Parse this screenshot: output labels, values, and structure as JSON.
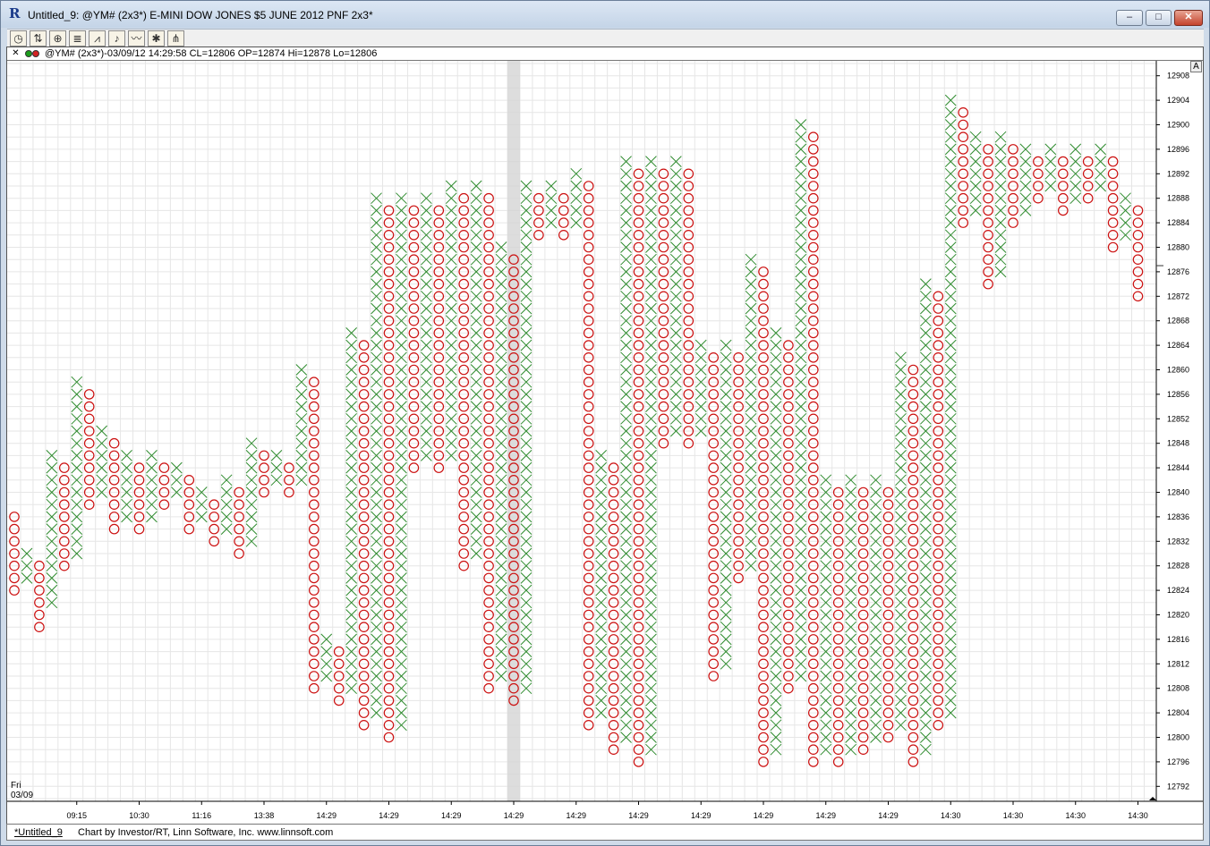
{
  "window": {
    "app_icon": "R",
    "title": "Untitled_9: @YM# (2x3*) E-MINI DOW JONES $5 JUNE 2012 PNF 2x3*",
    "min_symbol": "–",
    "max_symbol": "□",
    "close_symbol": "✕"
  },
  "toolbar": {
    "tools": [
      {
        "icon": "clock-icon",
        "glyph": "◷"
      },
      {
        "icon": "bar-chart-icon",
        "glyph": "⇅"
      },
      {
        "icon": "zoom-icon",
        "glyph": "⊕"
      },
      {
        "icon": "list-icon",
        "glyph": "≣"
      },
      {
        "icon": "line-chart-icon",
        "glyph": "⩘"
      },
      {
        "icon": "alert-bell-icon",
        "glyph": "♪"
      },
      {
        "icon": "indicator-icon",
        "glyph": "〰"
      },
      {
        "icon": "draw-icon",
        "glyph": "✱"
      },
      {
        "icon": "fib-icon",
        "glyph": "⋔"
      }
    ]
  },
  "info": {
    "close_symbol": "✕",
    "text": "@YM# (2x3*)-03/09/12 14:29:58 CL=12806 OP=12874 Hi=12878 Lo=12806"
  },
  "corner_button": "A",
  "day_label": {
    "day": "Fri",
    "date": "03/09"
  },
  "status": {
    "tab": "*Untitled_9",
    "credit": "Chart by Investor/RT, Linn Software, Inc. www.linnsoft.com"
  },
  "colors": {
    "x_mark": "#2e8b2e",
    "o_mark": "#cc1111",
    "grid": "#e6e6e6",
    "highlight": "#d4d4d4"
  },
  "chart_data": {
    "type": "point-and-figure",
    "box_size": 2,
    "reversal": 3,
    "ylim": [
      12790,
      12910
    ],
    "y_ticks": [
      12792,
      12796,
      12800,
      12804,
      12808,
      12812,
      12816,
      12820,
      12824,
      12828,
      12832,
      12836,
      12840,
      12844,
      12848,
      12852,
      12856,
      12860,
      12864,
      12868,
      12872,
      12876,
      12880,
      12884,
      12888,
      12892,
      12896,
      12900,
      12904,
      12908
    ],
    "last_price_marker": 12877,
    "highlight_column": 40,
    "time_labels": [
      {
        "col": 5,
        "label": "09:15"
      },
      {
        "col": 10,
        "label": "10:30"
      },
      {
        "col": 15,
        "label": "11:16"
      },
      {
        "col": 20,
        "label": "13:38"
      },
      {
        "col": 25,
        "label": "14:29"
      },
      {
        "col": 30,
        "label": "14:29"
      },
      {
        "col": 35,
        "label": "14:29"
      },
      {
        "col": 40,
        "label": "14:29"
      },
      {
        "col": 45,
        "label": "14:29"
      },
      {
        "col": 50,
        "label": "14:29"
      },
      {
        "col": 55,
        "label": "14:29"
      },
      {
        "col": 60,
        "label": "14:29"
      },
      {
        "col": 65,
        "label": "14:29"
      },
      {
        "col": 70,
        "label": "14:29"
      },
      {
        "col": 75,
        "label": "14:30"
      },
      {
        "col": 80,
        "label": "14:30"
      },
      {
        "col": 85,
        "label": "14:30"
      },
      {
        "col": 90,
        "label": "14:30"
      }
    ],
    "columns": [
      [
        "O",
        12836,
        12824
      ],
      [
        "X",
        12830,
        12826
      ],
      [
        "O",
        12828,
        12818
      ],
      [
        "X",
        12822,
        12846
      ],
      [
        "O",
        12844,
        12828
      ],
      [
        "X",
        12830,
        12858
      ],
      [
        "O",
        12856,
        12838
      ],
      [
        "X",
        12840,
        12850
      ],
      [
        "O",
        12848,
        12834
      ],
      [
        "X",
        12836,
        12846
      ],
      [
        "O",
        12844,
        12834
      ],
      [
        "X",
        12836,
        12846
      ],
      [
        "O",
        12844,
        12838
      ],
      [
        "X",
        12840,
        12844
      ],
      [
        "O",
        12842,
        12834
      ],
      [
        "X",
        12836,
        12840
      ],
      [
        "O",
        12838,
        12832
      ],
      [
        "X",
        12834,
        12842
      ],
      [
        "O",
        12840,
        12830
      ],
      [
        "X",
        12832,
        12848
      ],
      [
        "O",
        12846,
        12840
      ],
      [
        "X",
        12842,
        12846
      ],
      [
        "O",
        12844,
        12840
      ],
      [
        "X",
        12842,
        12860
      ],
      [
        "O",
        12858,
        12808
      ],
      [
        "X",
        12810,
        12816
      ],
      [
        "O",
        12814,
        12806
      ],
      [
        "X",
        12808,
        12866
      ],
      [
        "O",
        12864,
        12802
      ],
      [
        "X",
        12804,
        12888
      ],
      [
        "O",
        12886,
        12800
      ],
      [
        "X",
        12802,
        12888
      ],
      [
        "O",
        12886,
        12844
      ],
      [
        "X",
        12846,
        12888
      ],
      [
        "O",
        12886,
        12844
      ],
      [
        "X",
        12846,
        12890
      ],
      [
        "O",
        12888,
        12828
      ],
      [
        "X",
        12830,
        12890
      ],
      [
        "O",
        12888,
        12808
      ],
      [
        "X",
        12810,
        12880
      ],
      [
        "O",
        12878,
        12806
      ],
      [
        "X",
        12808,
        12890
      ],
      [
        "O",
        12888,
        12882
      ],
      [
        "X",
        12884,
        12890
      ],
      [
        "O",
        12888,
        12882
      ],
      [
        "X",
        12884,
        12892
      ],
      [
        "O",
        12890,
        12802
      ],
      [
        "X",
        12804,
        12846
      ],
      [
        "O",
        12844,
        12798
      ],
      [
        "X",
        12800,
        12894
      ],
      [
        "O",
        12892,
        12796
      ],
      [
        "X",
        12798,
        12894
      ],
      [
        "O",
        12892,
        12848
      ],
      [
        "X",
        12850,
        12894
      ],
      [
        "O",
        12892,
        12848
      ],
      [
        "X",
        12850,
        12864
      ],
      [
        "O",
        12862,
        12810
      ],
      [
        "X",
        12812,
        12864
      ],
      [
        "O",
        12862,
        12826
      ],
      [
        "X",
        12828,
        12878
      ],
      [
        "O",
        12876,
        12796
      ],
      [
        "X",
        12798,
        12866
      ],
      [
        "O",
        12864,
        12808
      ],
      [
        "X",
        12810,
        12900
      ],
      [
        "O",
        12898,
        12796
      ],
      [
        "X",
        12798,
        12842
      ],
      [
        "O",
        12840,
        12796
      ],
      [
        "X",
        12798,
        12842
      ],
      [
        "O",
        12840,
        12798
      ],
      [
        "X",
        12800,
        12842
      ],
      [
        "O",
        12840,
        12800
      ],
      [
        "X",
        12802,
        12862
      ],
      [
        "O",
        12860,
        12796
      ],
      [
        "X",
        12798,
        12874
      ],
      [
        "O",
        12872,
        12802
      ],
      [
        "X",
        12804,
        12904
      ],
      [
        "O",
        12902,
        12884
      ],
      [
        "X",
        12886,
        12898
      ],
      [
        "O",
        12896,
        12874
      ],
      [
        "X",
        12876,
        12898
      ],
      [
        "O",
        12896,
        12884
      ],
      [
        "X",
        12886,
        12896
      ],
      [
        "O",
        12894,
        12888
      ],
      [
        "X",
        12890,
        12896
      ],
      [
        "O",
        12894,
        12886
      ],
      [
        "X",
        12888,
        12896
      ],
      [
        "O",
        12894,
        12888
      ],
      [
        "X",
        12890,
        12896
      ],
      [
        "O",
        12894,
        12880
      ],
      [
        "X",
        12882,
        12888
      ],
      [
        "O",
        12886,
        12872
      ]
    ]
  }
}
